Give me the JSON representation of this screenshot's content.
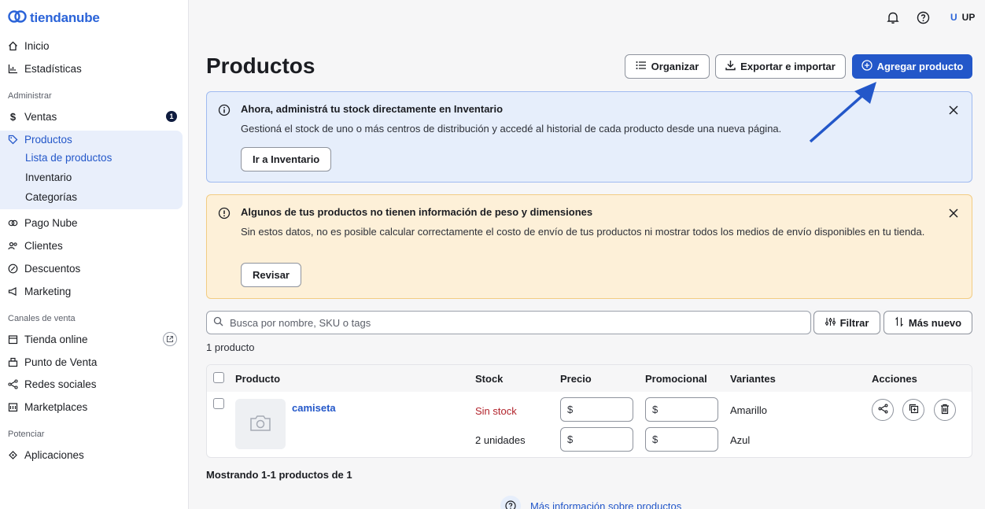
{
  "brand": {
    "name": "tiendanube",
    "accent": "#2357c9"
  },
  "sidebar": {
    "main": [
      {
        "label": "Inicio",
        "icon": "home-icon"
      },
      {
        "label": "Estadísticas",
        "icon": "chart-icon"
      }
    ],
    "section_admin": "Administrar",
    "ventas": {
      "label": "Ventas",
      "badge": "1"
    },
    "productos": {
      "label": "Productos",
      "sub": [
        "Lista de productos",
        "Inventario",
        "Categorías"
      ]
    },
    "admin_rest": [
      {
        "label": "Pago Nube",
        "icon": "pago-icon"
      },
      {
        "label": "Clientes",
        "icon": "users-icon"
      },
      {
        "label": "Descuentos",
        "icon": "discount-icon"
      },
      {
        "label": "Marketing",
        "icon": "megaphone-icon"
      }
    ],
    "section_channels": "Canales de venta",
    "channels": [
      {
        "label": "Tienda online",
        "icon": "store-icon"
      },
      {
        "label": "Punto de Venta",
        "icon": "pos-icon"
      },
      {
        "label": "Redes sociales",
        "icon": "share-icon"
      },
      {
        "label": "Marketplaces",
        "icon": "marketplace-icon"
      }
    ],
    "section_boost": "Potenciar",
    "boost": [
      {
        "label": "Aplicaciones",
        "icon": "apps-icon"
      }
    ]
  },
  "topbar": {
    "user_initial": "U",
    "user_name": "UP"
  },
  "header": {
    "title": "Productos",
    "organize": "Organizar",
    "export": "Exportar e importar",
    "add": "Agregar producto"
  },
  "alert_info": {
    "title": "Ahora, administrá tu stock directamente en Inventario",
    "text": "Gestioná el stock de uno o más centros de distribución y accedé al historial de cada producto desde una nueva página.",
    "button": "Ir a Inventario"
  },
  "alert_warn": {
    "title": "Algunos de tus productos no tienen información de peso y dimensiones",
    "text": "Sin estos datos, no es posible calcular correctamente el costo de envío de tus productos ni mostrar todos los medios de envío disponibles en tu tienda.",
    "button": "Revisar"
  },
  "search": {
    "placeholder": "Busca por nombre, SKU o tags",
    "filter": "Filtrar",
    "sort": "Más nuevo"
  },
  "product_count": "1 producto",
  "table": {
    "headers": [
      "Producto",
      "Stock",
      "Precio",
      "Promocional",
      "Variantes",
      "Acciones"
    ],
    "product_name": "camiseta",
    "rows": [
      {
        "stock": "Sin stock",
        "price_prefix": "$",
        "promo_prefix": "$",
        "variant": "Amarillo"
      },
      {
        "stock": "2 unidades",
        "price_prefix": "$",
        "promo_prefix": "$",
        "variant": "Azul"
      }
    ]
  },
  "showing": "Mostrando 1-1 productos de 1",
  "more_info": "Más información sobre productos"
}
